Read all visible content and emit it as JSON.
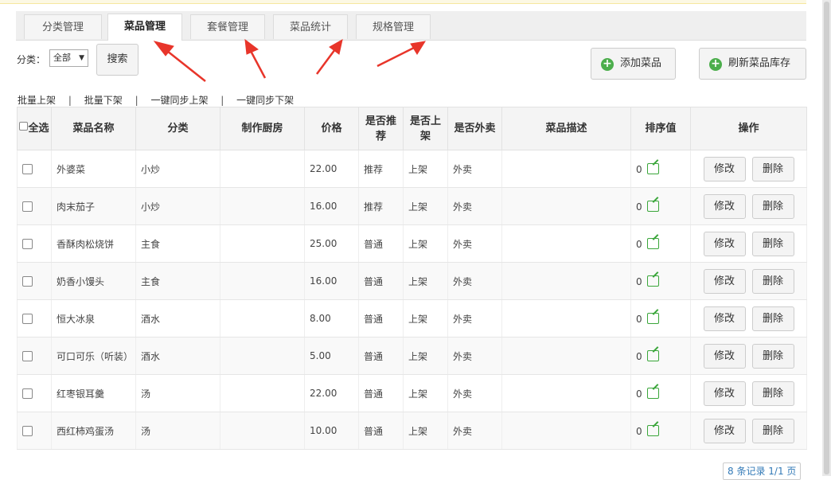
{
  "tabs": [
    {
      "label": "分类管理"
    },
    {
      "label": "菜品管理"
    },
    {
      "label": "套餐管理"
    },
    {
      "label": "菜品统计"
    },
    {
      "label": "规格管理"
    }
  ],
  "active_tab": "菜品管理",
  "filter": {
    "label": "分类：",
    "category_value": "全部",
    "caret": "▼",
    "search_label": "搜索"
  },
  "actions": {
    "add_label": "添加菜品",
    "refresh_label": "刷新菜品库存",
    "plus_glyph": "+"
  },
  "batch": [
    "批量上架",
    "批量下架",
    "一键同步上架",
    "一键同步下架"
  ],
  "separator": "|",
  "table": {
    "headers": [
      "全选",
      "菜品名称",
      "分类",
      "制作厨房",
      "价格",
      "是否推荐",
      "是否上架",
      "是否外卖",
      "菜品描述",
      "排序值",
      "操作"
    ],
    "rows": [
      {
        "name": "外婆菜",
        "category": "小炒",
        "kitchen": "",
        "price": "22.00",
        "recommend": "推荐",
        "onsale": "上架",
        "takeout": "外卖",
        "desc": "",
        "sort": "0",
        "edit": "修改",
        "delete": "删除"
      },
      {
        "name": "肉末茄子",
        "category": "小炒",
        "kitchen": "",
        "price": "16.00",
        "recommend": "推荐",
        "onsale": "上架",
        "takeout": "外卖",
        "desc": "",
        "sort": "0",
        "edit": "修改",
        "delete": "删除"
      },
      {
        "name": "香酥肉松烧饼",
        "category": "主食",
        "kitchen": "",
        "price": "25.00",
        "recommend": "普通",
        "onsale": "上架",
        "takeout": "外卖",
        "desc": "",
        "sort": "0",
        "edit": "修改",
        "delete": "删除"
      },
      {
        "name": "奶香小馒头",
        "category": "主食",
        "kitchen": "",
        "price": "16.00",
        "recommend": "普通",
        "onsale": "上架",
        "takeout": "外卖",
        "desc": "",
        "sort": "0",
        "edit": "修改",
        "delete": "删除"
      },
      {
        "name": "恒大冰泉",
        "category": "酒水",
        "kitchen": "",
        "price": "8.00",
        "recommend": "普通",
        "onsale": "上架",
        "takeout": "外卖",
        "desc": "",
        "sort": "0",
        "edit": "修改",
        "delete": "删除"
      },
      {
        "name": "可口可乐（听装）",
        "category": "酒水",
        "kitchen": "",
        "price": "5.00",
        "recommend": "普通",
        "onsale": "上架",
        "takeout": "外卖",
        "desc": "",
        "sort": "0",
        "edit": "修改",
        "delete": "删除"
      },
      {
        "name": "红枣银耳羹",
        "category": "汤",
        "kitchen": "",
        "price": "22.00",
        "recommend": "普通",
        "onsale": "上架",
        "takeout": "外卖",
        "desc": "",
        "sort": "0",
        "edit": "修改",
        "delete": "删除"
      },
      {
        "name": "西红柿鸡蛋汤",
        "category": "汤",
        "kitchen": "",
        "price": "10.00",
        "recommend": "普通",
        "onsale": "上架",
        "takeout": "外卖",
        "desc": "",
        "sort": "0",
        "edit": "修改",
        "delete": "删除"
      }
    ]
  },
  "pager": {
    "text": "8 条记录 1/1 页"
  },
  "colors": {
    "accent_green": "#2c8f2c",
    "arrow_red": "#e8352a",
    "pager_blue": "#337ab7"
  }
}
